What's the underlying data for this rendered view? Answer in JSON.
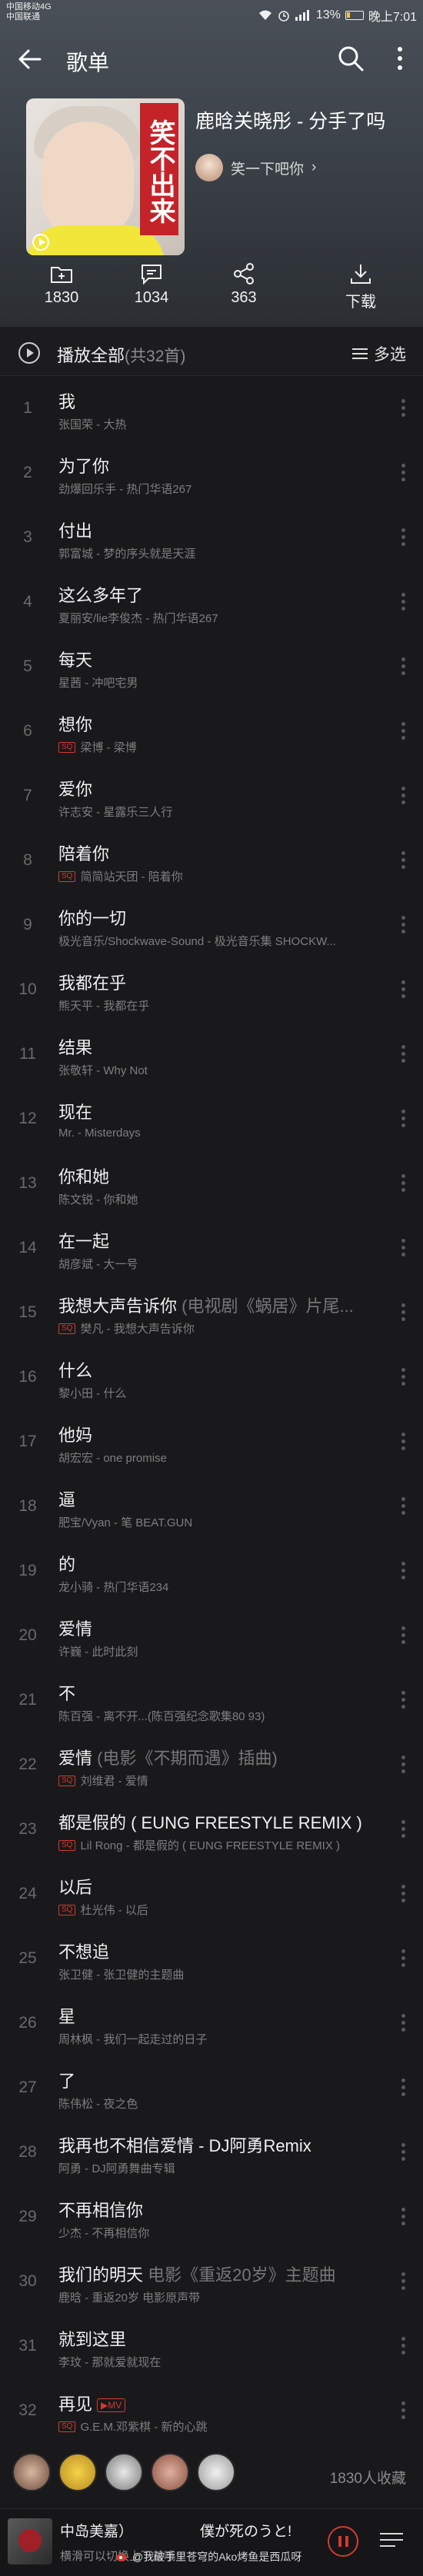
{
  "status_bar": {
    "carrier1": "中国移动4G",
    "carrier2": "中国联通",
    "battery": "13%",
    "time": "晚上7:01"
  },
  "topbar": {
    "title": "歌单"
  },
  "playlist": {
    "cover_text": "笑不出来",
    "title": "鹿晗关晓彤 - 分手了吗",
    "creator": "笑一下吧你",
    "creator_chevron": "›"
  },
  "actions": [
    {
      "icon": "add-folder-icon",
      "label": "1830"
    },
    {
      "icon": "comment-icon",
      "label": "1034"
    },
    {
      "icon": "share-icon",
      "label": "363"
    },
    {
      "icon": "download-icon",
      "label": "下载"
    }
  ],
  "play_all": {
    "label": "播放全部",
    "count": "(共32首)",
    "multi": "多选"
  },
  "songs": [
    {
      "num": "1",
      "title": "我",
      "extra": "",
      "sub": "张国荣 - 大热",
      "tag": false,
      "mv": false
    },
    {
      "num": "2",
      "title": "为了你",
      "extra": "",
      "sub": "劲爆回乐手 - 热门华语267",
      "tag": false,
      "mv": false
    },
    {
      "num": "3",
      "title": "付出",
      "extra": "",
      "sub": "郭富城 - 梦的序头就是天涯",
      "tag": false,
      "mv": false
    },
    {
      "num": "4",
      "title": "这么多年了",
      "extra": "",
      "sub": "夏丽安/lie李俊杰 - 热门华语267",
      "tag": false,
      "mv": false
    },
    {
      "num": "5",
      "title": "每天",
      "extra": "",
      "sub": "星茜 - 冲吧宅男",
      "tag": false,
      "mv": false
    },
    {
      "num": "6",
      "title": "想你",
      "extra": "",
      "sub": "梁博 - 梁博",
      "tag": true,
      "mv": false
    },
    {
      "num": "7",
      "title": "爱你",
      "extra": "",
      "sub": "许志安 - 星露乐三人行",
      "tag": false,
      "mv": false
    },
    {
      "num": "8",
      "title": "陪着你",
      "extra": "",
      "sub": "简简站天团 - 陪着你",
      "tag": true,
      "mv": false
    },
    {
      "num": "9",
      "title": "你的一切",
      "extra": "",
      "sub": "极光音乐/Shockwave-Sound - 极光音乐集 SHOCKW...",
      "tag": false,
      "mv": false
    },
    {
      "num": "10",
      "title": "我都在乎",
      "extra": "",
      "sub": "熊天平 - 我都在乎",
      "tag": false,
      "mv": false
    },
    {
      "num": "11",
      "title": "结果",
      "extra": "",
      "sub": "张敬轩 - Why Not",
      "tag": false,
      "mv": false
    },
    {
      "num": "12",
      "title": "现在",
      "extra": "",
      "sub": "Mr. - Misterdays",
      "tag": false,
      "mv": false
    },
    {
      "num": "13",
      "title": "你和她",
      "extra": "",
      "sub": "陈文锐 - 你和她",
      "tag": false,
      "mv": false
    },
    {
      "num": "14",
      "title": "在一起",
      "extra": "",
      "sub": "胡彦斌 - 大一号",
      "tag": false,
      "mv": false
    },
    {
      "num": "15",
      "title": "我想大声告诉你",
      "extra": " (电视剧《蜗居》片尾...",
      "sub": "樊凡 - 我想大声告诉你",
      "tag": true,
      "mv": false
    },
    {
      "num": "16",
      "title": "什么",
      "extra": "",
      "sub": "黎小田 - 什么",
      "tag": false,
      "mv": false
    },
    {
      "num": "17",
      "title": "他妈",
      "extra": "",
      "sub": "胡宏宏 - one promise",
      "tag": false,
      "mv": false
    },
    {
      "num": "18",
      "title": "逼",
      "extra": "",
      "sub": "肥宝/Vyan - 笔 BEAT.GUN",
      "tag": false,
      "mv": false
    },
    {
      "num": "19",
      "title": "的",
      "extra": "",
      "sub": "龙小骑 - 热门华语234",
      "tag": false,
      "mv": false
    },
    {
      "num": "20",
      "title": "爱情",
      "extra": "",
      "sub": "许巍 - 此时此刻",
      "tag": false,
      "mv": false
    },
    {
      "num": "21",
      "title": "不",
      "extra": "",
      "sub": "陈百强 - 离不开...(陈百强纪念歌集80 93)",
      "tag": false,
      "mv": false
    },
    {
      "num": "22",
      "title": "爱情",
      "extra": " (电影《不期而遇》插曲)",
      "sub": "刘维君 - 爱情",
      "tag": true,
      "mv": false
    },
    {
      "num": "23",
      "title": "都是假的 ( EUNG FREESTYLE REMIX )",
      "extra": "",
      "sub": "Lil Rong - 都是假的 ( EUNG FREESTYLE REMIX )",
      "tag": true,
      "mv": false
    },
    {
      "num": "24",
      "title": "以后",
      "extra": "",
      "sub": "杜光伟 - 以后",
      "tag": true,
      "mv": false
    },
    {
      "num": "25",
      "title": "不想追",
      "extra": "",
      "sub": "张卫健 - 张卫健的主题曲",
      "tag": false,
      "mv": false
    },
    {
      "num": "26",
      "title": "星",
      "extra": "",
      "sub": "周林枫 - 我们一起走过的日子",
      "tag": false,
      "mv": false
    },
    {
      "num": "27",
      "title": "了",
      "extra": "",
      "sub": "陈伟松 - 夜之色",
      "tag": false,
      "mv": false
    },
    {
      "num": "28",
      "title": "我再也不相信爱情 - DJ阿勇Remix",
      "extra": "",
      "sub": "阿勇 - DJ阿勇舞曲专辑",
      "tag": false,
      "mv": false
    },
    {
      "num": "29",
      "title": "不再相信你",
      "extra": "",
      "sub": "少杰 - 不再相信你",
      "tag": false,
      "mv": false
    },
    {
      "num": "30",
      "title": "我们的明天",
      "extra": " 电影《重返20岁》主题曲",
      "sub": "鹿晗 - 重返20岁 电影原声带",
      "tag": false,
      "mv": false
    },
    {
      "num": "31",
      "title": "就到这里",
      "extra": "",
      "sub": "李玟 - 那就爱就现在",
      "tag": false,
      "mv": false
    },
    {
      "num": "32",
      "title": "再见",
      "extra": "",
      "sub": "G.E.M.邓紫棋 - 新的心跳",
      "tag": true,
      "mv": true
    }
  ],
  "song_tag_label": "SQ",
  "mv_label": "▶MV",
  "followers": {
    "count": "1830人收藏"
  },
  "player": {
    "title": "中岛美嘉）",
    "lyric": "僕が死のうと!",
    "sub": "横滑可以切换上下首哦",
    "watermark": "@我破手里苍穹的Ako烤鱼是西瓜呀"
  }
}
